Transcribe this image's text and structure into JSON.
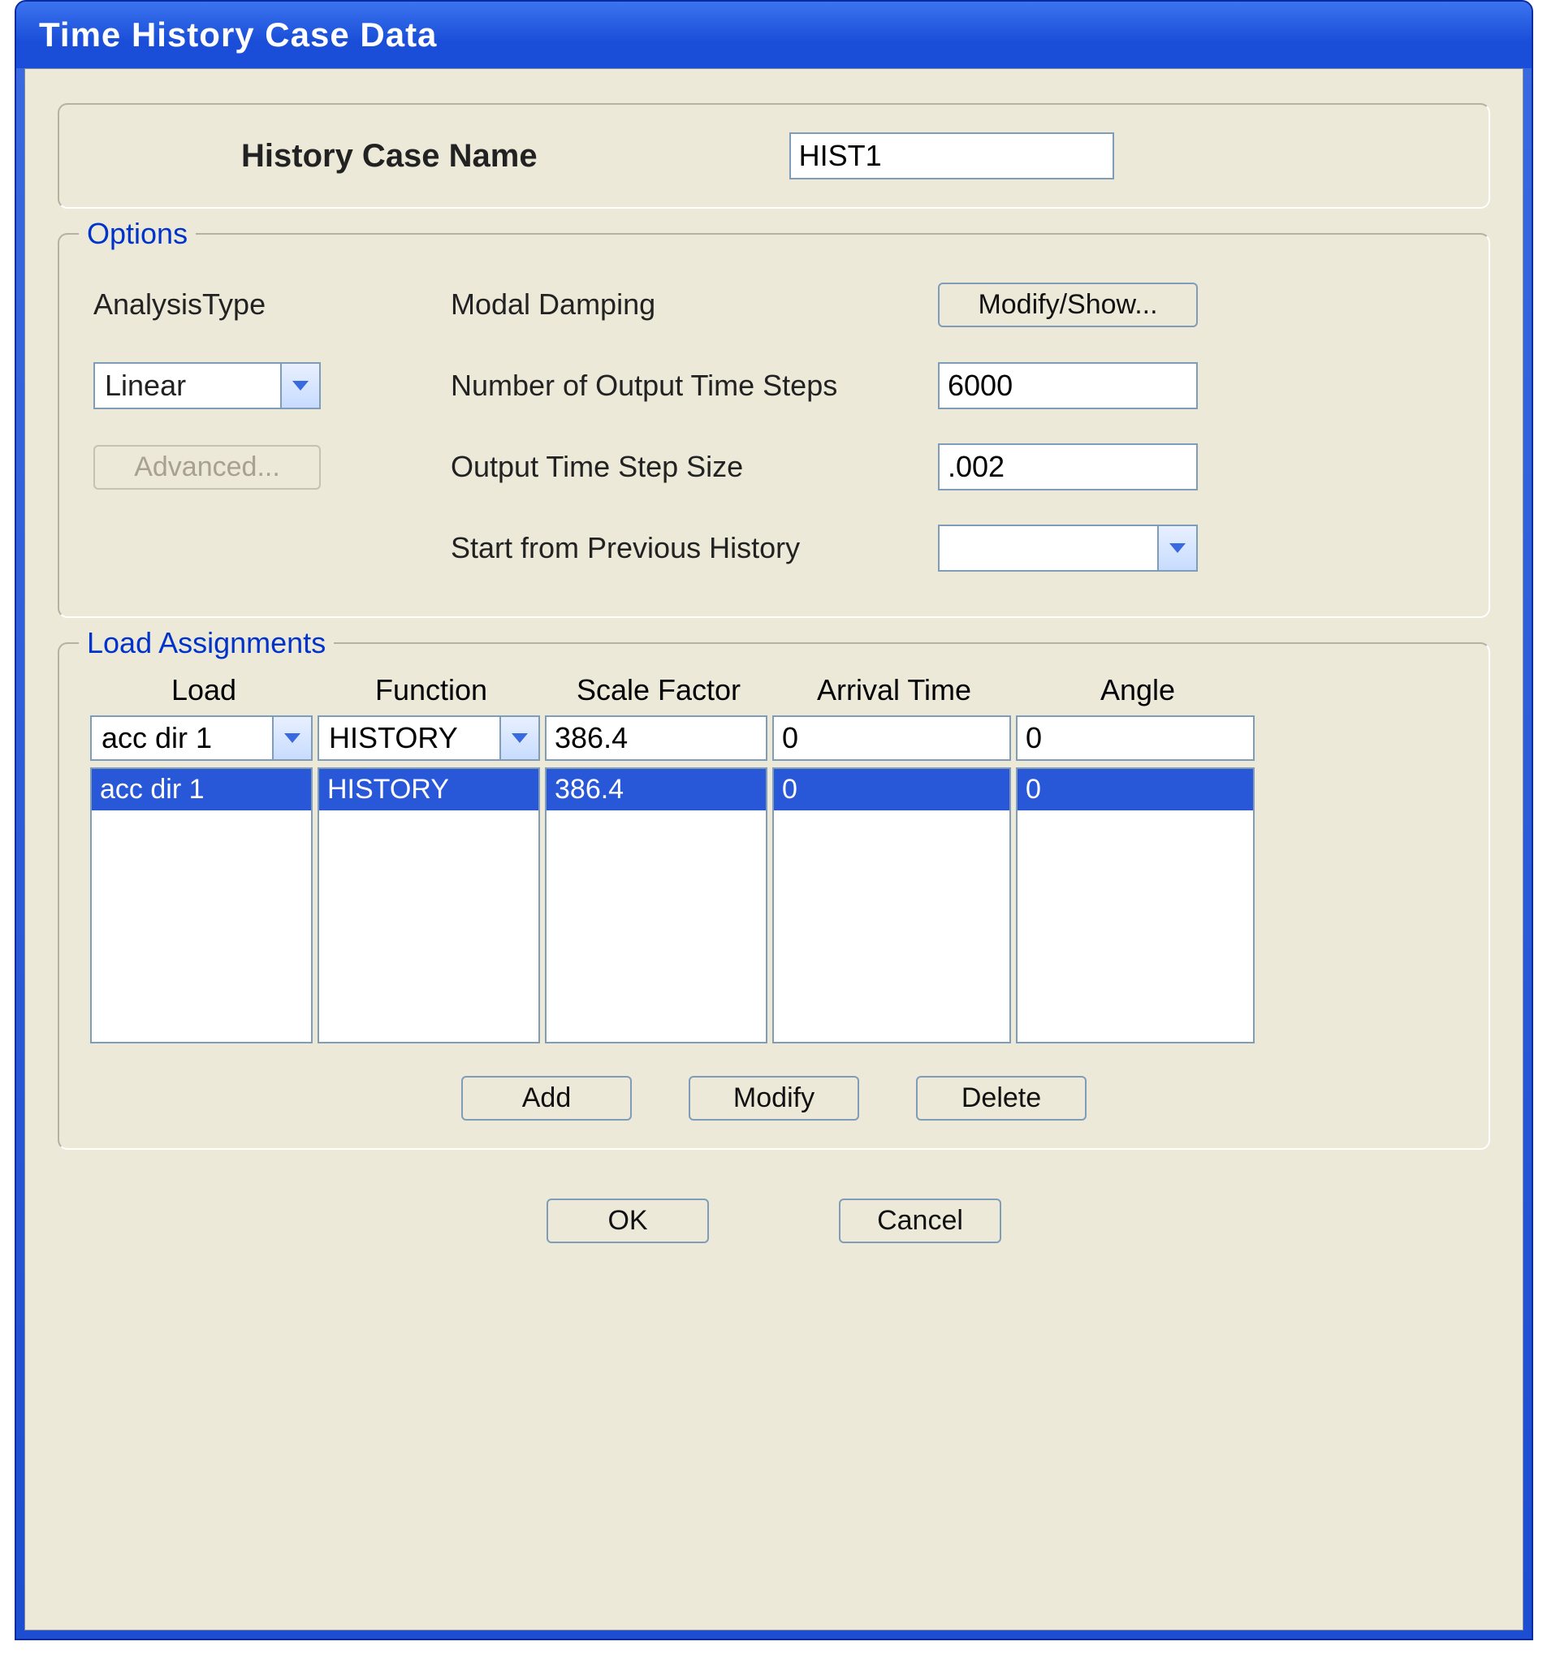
{
  "window": {
    "title": "Time History Case Data"
  },
  "header": {
    "label": "History Case Name",
    "value": "HIST1"
  },
  "options": {
    "legend": "Options",
    "analysis_type_label": "AnalysisType",
    "analysis_type_value": "Linear",
    "advanced_button": "Advanced...",
    "modal_damping_label": "Modal Damping",
    "modify_show_button": "Modify/Show...",
    "num_steps_label": "Number of Output Time Steps",
    "num_steps_value": "6000",
    "step_size_label": "Output Time Step Size",
    "step_size_value": ".002",
    "prev_history_label": "Start from Previous History",
    "prev_history_value": ""
  },
  "loads": {
    "legend": "Load Assignments",
    "headers": {
      "load": "Load",
      "function": "Function",
      "scale": "Scale Factor",
      "arrival": "Arrival Time",
      "angle": "Angle"
    },
    "input": {
      "load": "acc dir 1",
      "function": "HISTORY",
      "scale": "386.4",
      "arrival": "0",
      "angle": "0"
    },
    "rows": [
      {
        "load": "acc dir 1",
        "function": "HISTORY",
        "scale": "386.4",
        "arrival": "0",
        "angle": "0"
      }
    ],
    "buttons": {
      "add": "Add",
      "modify": "Modify",
      "delete": "Delete"
    }
  },
  "footer": {
    "ok": "OK",
    "cancel": "Cancel"
  }
}
